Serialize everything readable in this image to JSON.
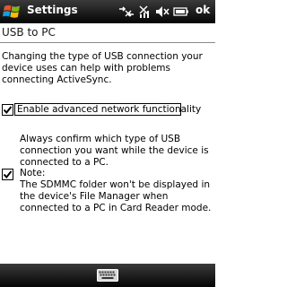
{
  "window": {
    "title": "Settings",
    "ok_label": "ok",
    "icons": [
      "windows-start-icon",
      "connectivity-icon",
      "no-signal-icon",
      "volume-muted-icon",
      "battery-icon"
    ]
  },
  "page": {
    "title": "USB to PC",
    "description": "Changing the type of USB connection your device uses can help with problems connecting ActiveSync.",
    "option1": {
      "label": "Enable advanced network functionality",
      "checked": true
    },
    "option2": {
      "checked": true,
      "label": "Always confirm which type of USB connection you want while the device is connected to a PC.",
      "note_title": "Note:",
      "note_body": "The SDMMC folder won't be displayed in the device's File Manager when connected to a PC in Card Reader mode."
    }
  },
  "softkeys": {
    "center_icon": "keyboard-icon"
  },
  "colors": {
    "bar": "#050505",
    "bar_highlight": "#3a3a3a",
    "text": "#000000",
    "background": "#ffffff"
  }
}
